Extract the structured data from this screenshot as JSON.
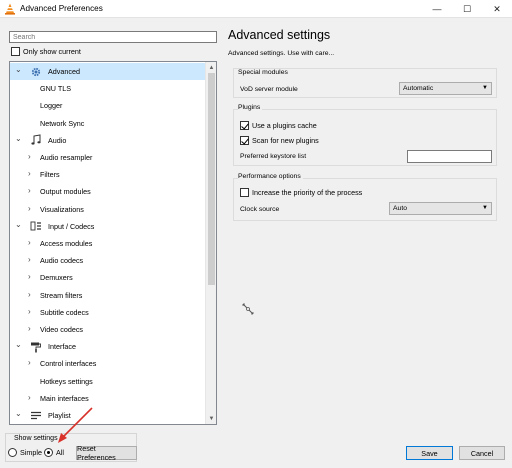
{
  "window": {
    "title": "Advanced Preferences",
    "minimize": "—",
    "maximize": "☐",
    "close": "✕"
  },
  "left": {
    "search_placeholder": "Search",
    "only_show_current": "Only show current",
    "tree": [
      {
        "label": "Advanced",
        "level": 0,
        "expanded": true,
        "icon": "gear-icon",
        "selected": true
      },
      {
        "label": "GNU TLS",
        "level": 1
      },
      {
        "label": "Logger",
        "level": 1
      },
      {
        "label": "Network Sync",
        "level": 1
      },
      {
        "label": "Audio",
        "level": 0,
        "expanded": true,
        "icon": "music-note-icon"
      },
      {
        "label": "Audio resampler",
        "level": 1,
        "collapsed": true
      },
      {
        "label": "Filters",
        "level": 1,
        "collapsed": true
      },
      {
        "label": "Output modules",
        "level": 1,
        "collapsed": true
      },
      {
        "label": "Visualizations",
        "level": 1,
        "collapsed": true
      },
      {
        "label": "Input / Codecs",
        "level": 0,
        "expanded": true,
        "icon": "codecs-icon"
      },
      {
        "label": "Access modules",
        "level": 1,
        "collapsed": true
      },
      {
        "label": "Audio codecs",
        "level": 1,
        "collapsed": true
      },
      {
        "label": "Demuxers",
        "level": 1,
        "collapsed": true
      },
      {
        "label": "Stream filters",
        "level": 1,
        "collapsed": true
      },
      {
        "label": "Subtitle codecs",
        "level": 1,
        "collapsed": true
      },
      {
        "label": "Video codecs",
        "level": 1,
        "collapsed": true
      },
      {
        "label": "Interface",
        "level": 0,
        "expanded": true,
        "icon": "paint-roller-icon"
      },
      {
        "label": "Control interfaces",
        "level": 1,
        "collapsed": true
      },
      {
        "label": "Hotkeys settings",
        "level": 1
      },
      {
        "label": "Main interfaces",
        "level": 1,
        "collapsed": true
      },
      {
        "label": "Playlist",
        "level": 0,
        "expanded": true,
        "icon": "playlist-icon"
      }
    ]
  },
  "bottom": {
    "show_settings": "Show settings",
    "simple": "Simple",
    "all": "All",
    "selected_mode": "All",
    "reset": "Reset Preferences",
    "save": "Save",
    "cancel": "Cancel"
  },
  "right": {
    "heading": "Advanced settings",
    "description": "Advanced settings. Use with care...",
    "special_modules": {
      "title": "Special modules",
      "vod_label": "VoD server module",
      "vod_value": "Automatic"
    },
    "plugins": {
      "title": "Plugins",
      "use_cache": "Use a plugins cache",
      "use_cache_checked": true,
      "scan_new": "Scan for new plugins",
      "scan_new_checked": true,
      "keystore_label": "Preferred keystore list",
      "keystore_value": ""
    },
    "performance": {
      "title": "Performance options",
      "increase_priority": "Increase the priority of the process",
      "increase_priority_checked": false,
      "clock_label": "Clock source",
      "clock_value": "Auto"
    }
  },
  "colors": {
    "selection": "#cce8ff",
    "annotation_arrow": "#d9322b",
    "accent": "#0078d7"
  }
}
